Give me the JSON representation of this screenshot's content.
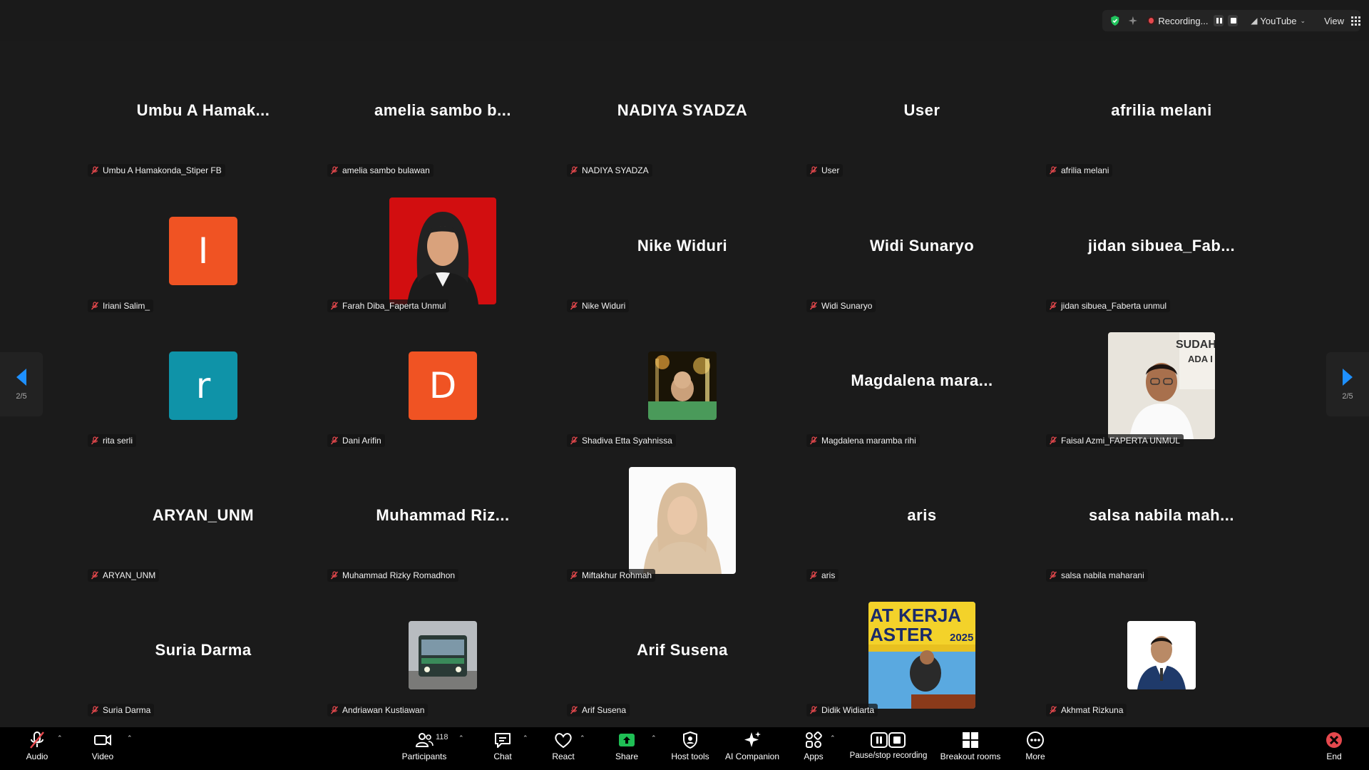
{
  "top_bar": {
    "recording_label": "Recording...",
    "stream_label": "YouTube",
    "view_label": "View",
    "icons": [
      "shield-check-icon",
      "sparkle-icon",
      "record-dot-icon",
      "pause-icon",
      "stop-icon",
      "livestream-icon",
      "grid-view-icon"
    ]
  },
  "pager": {
    "page_text": "2/5"
  },
  "tiles": [
    {
      "name": "Umbu A Hamakonda_Stiper FB",
      "big": "Umbu  A  Hamak...",
      "kind": "name"
    },
    {
      "name": "amelia sambo bulawan",
      "big": "amelia  sambo  b...",
      "kind": "name"
    },
    {
      "name": "NADIYA SYADZA",
      "big": "NADIYA  SYADZA",
      "kind": "name"
    },
    {
      "name": "User",
      "big": "User",
      "kind": "name"
    },
    {
      "name": "afrilia melani",
      "big": "afrilia  melani",
      "kind": "name"
    },
    {
      "name": "Iriani Salim_",
      "avatar": "I",
      "color": "#f05323",
      "kind": "avatar"
    },
    {
      "name": "Farah Diba_Faperta Unmul",
      "kind": "photo-hijab-red"
    },
    {
      "name": "Nike Widuri",
      "big": "Nike  Widuri",
      "kind": "name"
    },
    {
      "name": "Widi Sunaryo",
      "big": "Widi  Sunaryo",
      "kind": "name"
    },
    {
      "name": "jidan sibuea_Faberta unmul",
      "big": "jidan  sibuea_Fab...",
      "kind": "name"
    },
    {
      "name": "rita serli",
      "avatar": "r",
      "color": "#0f93a8",
      "kind": "avatar"
    },
    {
      "name": "Dani Arifin",
      "avatar": "D",
      "color": "#f05323",
      "kind": "avatar"
    },
    {
      "name": "Shadiva Etta Syahnissa",
      "kind": "photo-baby"
    },
    {
      "name": "Magdalena maramba rihi",
      "big": "Magdalena  mara...",
      "kind": "name"
    },
    {
      "name": "Faisal Azmi_FAPERTA UNMUL",
      "kind": "photo-man-white"
    },
    {
      "name": "ARYAN_UNM",
      "big": "ARYAN_UNM",
      "kind": "name"
    },
    {
      "name": "Muhammad Rizky Romadhon",
      "big": "Muhammad  Riz...",
      "kind": "name"
    },
    {
      "name": "Miftakhur Rohmah",
      "kind": "photo-hijab-beige"
    },
    {
      "name": "aris",
      "big": "aris",
      "kind": "name"
    },
    {
      "name": "salsa nabila maharani",
      "big": "salsa  nabila  mah...",
      "kind": "name"
    },
    {
      "name": "Suria Darma",
      "big": "Suria  Darma",
      "kind": "name"
    },
    {
      "name": "Andriawan Kustiawan",
      "kind": "photo-bus"
    },
    {
      "name": "Arif Susena",
      "big": "Arif  Susena",
      "kind": "name"
    },
    {
      "name": "Didik Widiarta",
      "kind": "photo-banner"
    },
    {
      "name": "Akhmat Rizkuna",
      "kind": "photo-suit"
    }
  ],
  "banner_text": {
    "line1": "AT KERJA",
    "line2": "ASTER",
    "year": "2025"
  },
  "toolbar": {
    "audio": "Audio",
    "video": "Video",
    "participants": "Participants",
    "participants_count": "118",
    "chat": "Chat",
    "react": "React",
    "share": "Share",
    "host_tools": "Host tools",
    "ai_companion": "AI Companion",
    "apps": "Apps",
    "pause_stop_recording": "Pause/stop recording",
    "breakout_rooms": "Breakout rooms",
    "more": "More",
    "end": "End"
  },
  "colors": {
    "accent_blue": "#1e90ff",
    "end_red": "#e5484d",
    "share_green": "#1fbf55"
  }
}
